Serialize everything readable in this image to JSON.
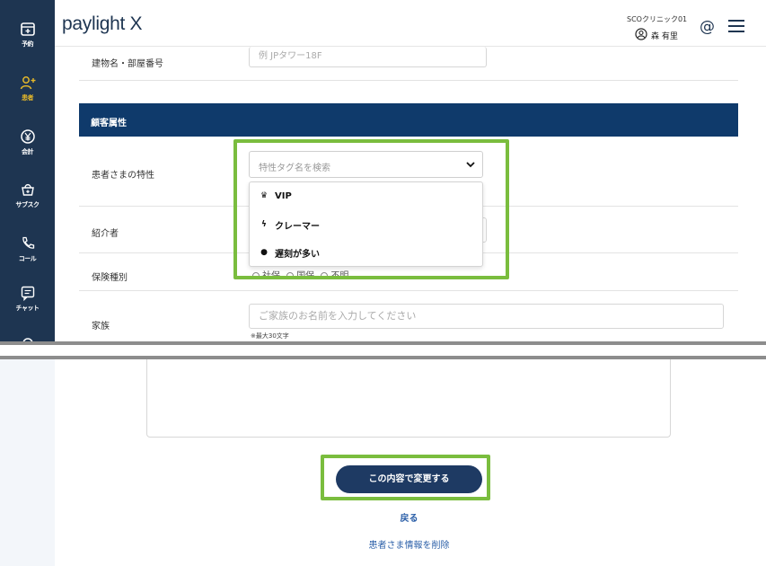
{
  "header": {
    "logo": "paylight X",
    "clinic_name": "SCOクリニック01",
    "user_name": "森 有里"
  },
  "sidebar": {
    "items": [
      {
        "label": "予約",
        "icon": "calendar-plus-icon"
      },
      {
        "label": "患者",
        "icon": "user-plus-icon",
        "active": true
      },
      {
        "label": "会計",
        "icon": "yen-icon"
      },
      {
        "label": "サブスク",
        "icon": "basket-plus-icon"
      },
      {
        "label": "コール",
        "icon": "phone-icon"
      },
      {
        "label": "チャット",
        "icon": "chat-icon"
      }
    ]
  },
  "form": {
    "building_label": "建物名・部屋番号",
    "building_placeholder": "例 JPタワー18F",
    "section_title": "顧客属性",
    "trait_label": "患者さまの特性",
    "trait_placeholder": "特性タグ名を検索",
    "referrer_label": "紹介者",
    "insurance_label": "保険種別",
    "insurance_options": [
      "社保",
      "国保",
      "不明"
    ],
    "family_label": "家族",
    "family_placeholder": "ご家族のお名前を入力してください",
    "family_hint": "※最大30文字"
  },
  "dropdown": {
    "options": [
      {
        "label": "VIP",
        "icon": "crown-icon"
      },
      {
        "label": "クレーマー",
        "icon": "lightning-icon"
      },
      {
        "label": "遅刻が多い",
        "icon": "clock-icon"
      }
    ]
  },
  "actions": {
    "submit_label": "この内容で変更する",
    "back_label": "戻る",
    "delete_label": "患者さま情報を削除"
  },
  "colors": {
    "sidebar": "#1e3551",
    "active": "#e5b82a",
    "section_header": "#0f3a6b",
    "highlight": "#7abd3e",
    "link": "#2b5fa8"
  }
}
